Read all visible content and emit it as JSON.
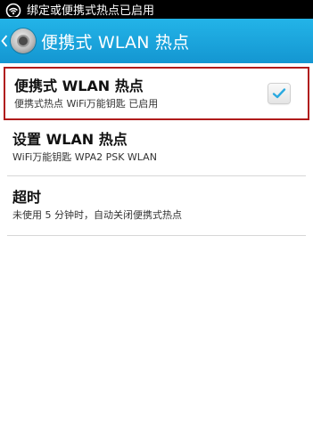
{
  "status_bar": {
    "notification_text": "绑定或便携式热点已启用",
    "icon": "wifi-hotspot-icon"
  },
  "action_bar": {
    "back_icon": "back-chevron-icon",
    "app_icon": "settings-gear-icon",
    "title": "便携式 WLAN 热点",
    "color": "#1aa6de"
  },
  "settings": [
    {
      "title": "便携式 WLAN 热点",
      "summary": "便携式热点 WiFi万能钥匙 已启用",
      "checked": true,
      "highlighted": true,
      "highlight_color": "#b01b1b"
    },
    {
      "title": "设置 WLAN 热点",
      "summary": "WiFi万能钥匙 WPA2 PSK WLAN"
    },
    {
      "title": "超时",
      "summary": "未使用 5 分钟时，自动关闭便携式热点"
    }
  ],
  "colors": {
    "check": "#29a9e0",
    "divider": "#d7d7d7"
  }
}
